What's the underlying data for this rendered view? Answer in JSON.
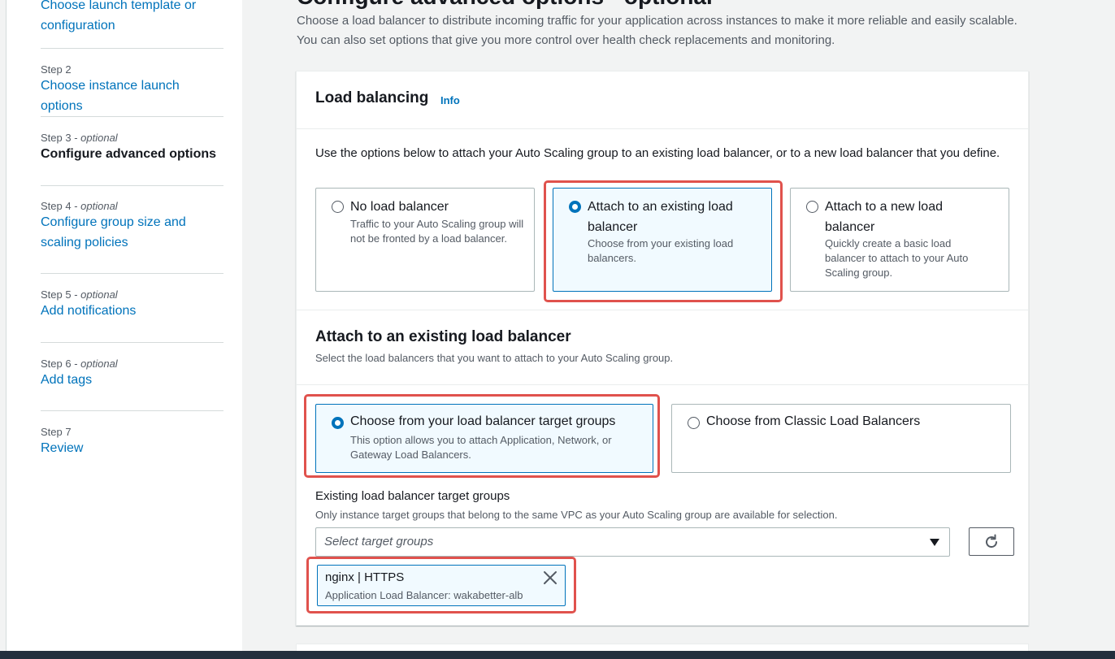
{
  "sidebar": {
    "steps": [
      {
        "title": "Choose launch template or configuration"
      },
      {
        "number": "Step 2",
        "title": "Choose instance launch options"
      },
      {
        "number": "Step 3",
        "optional": "optional",
        "title": "Configure advanced options"
      },
      {
        "number": "Step 4",
        "optional": "optional",
        "title": "Configure group size and scaling policies"
      },
      {
        "number": "Step 5",
        "optional": "optional",
        "title": "Add notifications"
      },
      {
        "number": "Step 6",
        "optional": "optional",
        "title": "Add tags"
      },
      {
        "number": "Step 7",
        "title": "Review"
      }
    ],
    "optional_prefix": " - "
  },
  "main": {
    "heading": "Configure advanced options - optional",
    "description": "Choose a load balancer to distribute incoming traffic for your application across instances to make it more reliable and easily scalable. You can also set options that give you more control over health check replacements and monitoring."
  },
  "load_balancing": {
    "title": "Load balancing",
    "info": "Info",
    "intro": "Use the options below to attach your Auto Scaling group to an existing load balancer, or to a new load balancer that you define.",
    "options": [
      {
        "label": "No load balancer",
        "description": "Traffic to your Auto Scaling group will not be fronted by a load balancer.",
        "selected": false
      },
      {
        "label": "Attach to an existing load balancer",
        "description": "Choose from your existing load balancers.",
        "selected": true
      },
      {
        "label": "Attach to a new load balancer",
        "description": "Quickly create a basic load balancer to attach to your Auto Scaling group.",
        "selected": false
      }
    ]
  },
  "existing_lb": {
    "title": "Attach to an existing load balancer",
    "description": "Select the load balancers that you want to attach to your Auto Scaling group.",
    "options": [
      {
        "label": "Choose from your load balancer target groups",
        "description": "This option allows you to attach Application, Network, or Gateway Load Balancers.",
        "selected": true
      },
      {
        "label": "Choose from Classic Load Balancers",
        "selected": false
      }
    ],
    "target_groups": {
      "label": "Existing load balancer target groups",
      "hint": "Only instance target groups that belong to the same VPC as your Auto Scaling group are available for selection.",
      "placeholder": "Select target groups",
      "selected_token": {
        "name": "nginx | HTTPS",
        "detail": "Application Load Balancer: wakabetter-alb"
      }
    }
  },
  "colors": {
    "link": "#0073bb",
    "highlight": "#e0524d",
    "selected_bg": "#f1faff"
  },
  "icons": {
    "refresh": "refresh-icon",
    "remove": "close-icon",
    "dropdown": "caret-down-icon"
  }
}
